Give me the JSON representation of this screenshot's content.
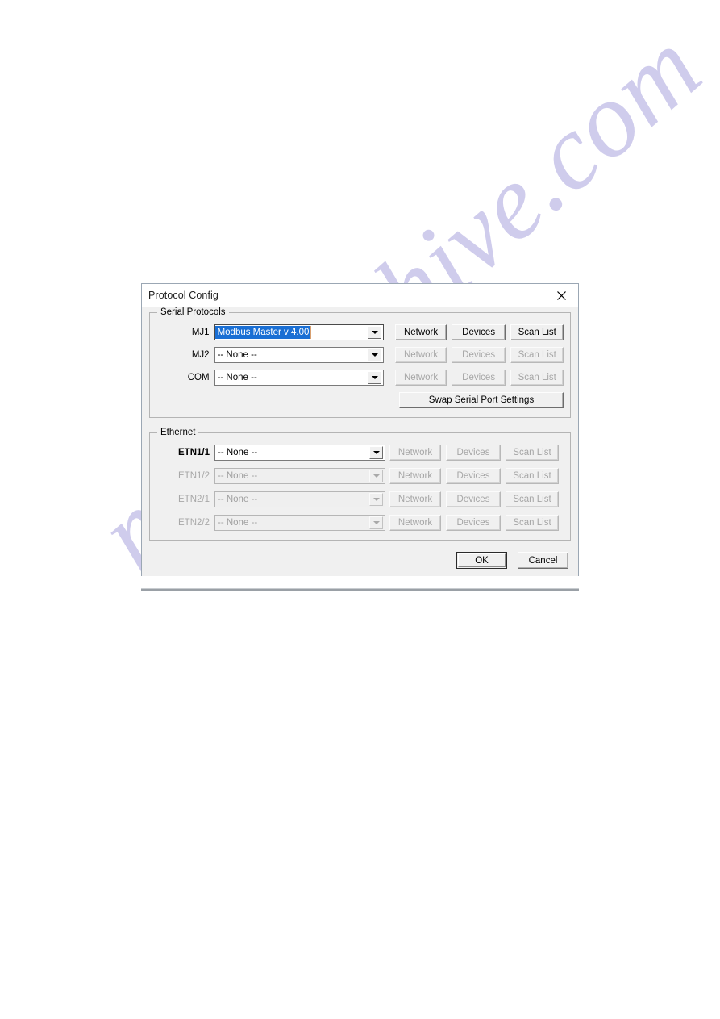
{
  "window": {
    "title": "Protocol Config",
    "close_icon": "close-icon"
  },
  "serial_group": {
    "legend": "Serial Protocols",
    "rows": [
      {
        "label": "MJ1",
        "value": "Modbus Master  v 4.00",
        "selected": true,
        "enabled": true,
        "buttons": [
          "Network",
          "Devices",
          "Scan List"
        ]
      },
      {
        "label": "MJ2",
        "value": "-- None --",
        "selected": false,
        "enabled": true,
        "buttons": [
          "Network",
          "Devices",
          "Scan List"
        ]
      },
      {
        "label": "COM",
        "value": "-- None --",
        "selected": false,
        "enabled": true,
        "buttons": [
          "Network",
          "Devices",
          "Scan List"
        ]
      }
    ],
    "swap_button": "Swap Serial Port Settings"
  },
  "ethernet_group": {
    "legend": "Ethernet",
    "rows": [
      {
        "label": "ETN1/1",
        "value": "-- None --",
        "enabled": true,
        "buttons": [
          "Network",
          "Devices",
          "Scan List"
        ]
      },
      {
        "label": "ETN1/2",
        "value": "-- None --",
        "enabled": false,
        "buttons": [
          "Network",
          "Devices",
          "Scan List"
        ]
      },
      {
        "label": "ETN2/1",
        "value": "-- None --",
        "enabled": false,
        "buttons": [
          "Network",
          "Devices",
          "Scan List"
        ]
      },
      {
        "label": "ETN2/2",
        "value": "-- None --",
        "enabled": false,
        "buttons": [
          "Network",
          "Devices",
          "Scan List"
        ]
      }
    ]
  },
  "footer": {
    "ok_label": "OK",
    "cancel_label": "Cancel"
  },
  "watermark": {
    "text": "manualshive.com"
  },
  "colors": {
    "selection_blue": "#1a6fd4",
    "dialog_face": "#f0f0f0",
    "disabled_text": "#a6a6a6",
    "watermark": "#a9a3dd"
  }
}
